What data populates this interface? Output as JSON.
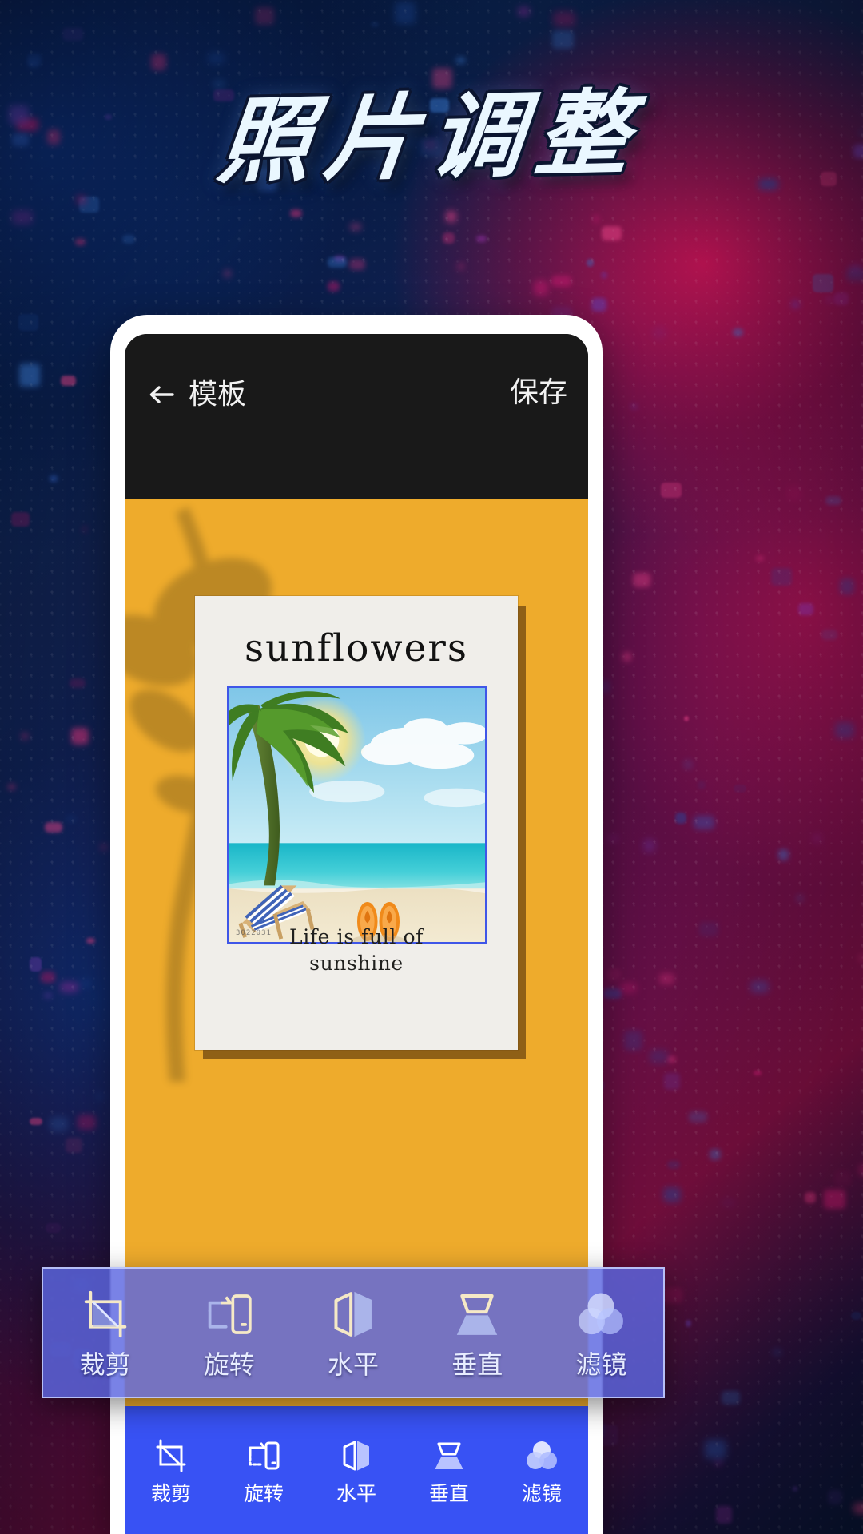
{
  "promo": {
    "title": "照片调整",
    "accent_purple": "#5c66e0",
    "accent_blue": "#3852f4",
    "canvas_orange": "#eeab2c"
  },
  "appbar": {
    "back_icon": "arrow-left-icon",
    "title": "模板",
    "save_label": "保存",
    "background": "#191919",
    "text_color": "#f2f2f2"
  },
  "poster": {
    "heading": "sunflowers",
    "caption_line1": "Life is full of",
    "caption_line2": "sunshine",
    "watermark": "3022031",
    "paper_color": "#f0eeea",
    "selection_border_color": "#3f56e8"
  },
  "toolbar": {
    "items": [
      {
        "label": "裁剪",
        "icon": "crop-icon"
      },
      {
        "label": "旋转",
        "icon": "rotate-icon"
      },
      {
        "label": "水平",
        "icon": "flip-horizontal-icon"
      },
      {
        "label": "垂直",
        "icon": "flip-vertical-icon"
      },
      {
        "label": "滤镜",
        "icon": "filter-circles-icon"
      }
    ]
  },
  "callout_toolbar": {
    "items": [
      {
        "label": "裁剪",
        "icon": "crop-icon"
      },
      {
        "label": "旋转",
        "icon": "rotate-icon"
      },
      {
        "label": "水平",
        "icon": "flip-horizontal-icon"
      },
      {
        "label": "垂直",
        "icon": "flip-vertical-icon"
      },
      {
        "label": "滤镜",
        "icon": "filter-circles-icon"
      }
    ]
  }
}
